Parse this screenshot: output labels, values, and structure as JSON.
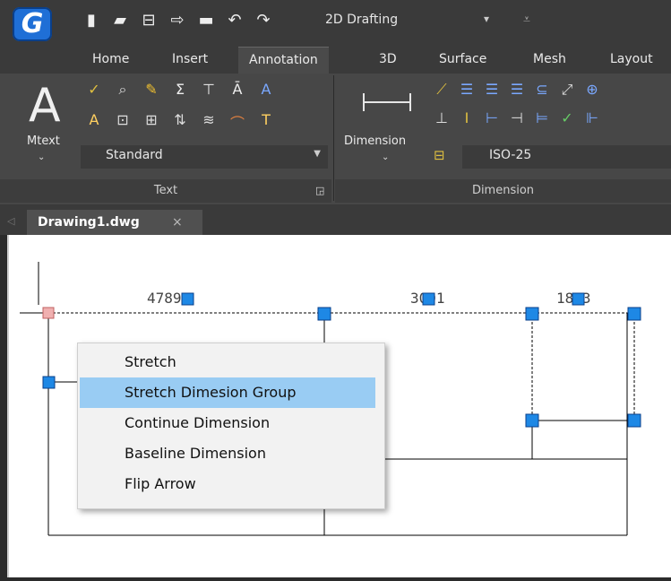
{
  "app": {
    "logo_letter": "G",
    "workspace": "2D Drafting"
  },
  "quick_access": [
    "new-icon",
    "open-icon",
    "save-icon",
    "saveas-icon",
    "print-icon",
    "undo-icon",
    "redo-icon"
  ],
  "ribbon_tabs": [
    "Home",
    "Insert",
    "Annotation",
    "3D",
    "Surface",
    "Mesh",
    "Layout"
  ],
  "active_tab": "Annotation",
  "text_panel": {
    "mtext_label": "Mtext",
    "style_value": "Standard",
    "title": "Text"
  },
  "dimension_panel": {
    "dimension_label": "Dimension",
    "style_value": "ISO-25",
    "title": "Dimension"
  },
  "document": {
    "tab_label": "Drawing1.dwg",
    "close_glyph": "×"
  },
  "drawing": {
    "dimension_texts": [
      "4789",
      "3001",
      "1833"
    ]
  },
  "context_menu": {
    "items": [
      "Stretch",
      "Stretch Dimesion Group",
      "Continue Dimension",
      "Baseline Dimension",
      "Flip Arrow"
    ],
    "highlighted_index": 1
  },
  "colors": {
    "highlight": "#99ccf3",
    "grip": "#1e88e5",
    "ribbon": "#474747"
  }
}
